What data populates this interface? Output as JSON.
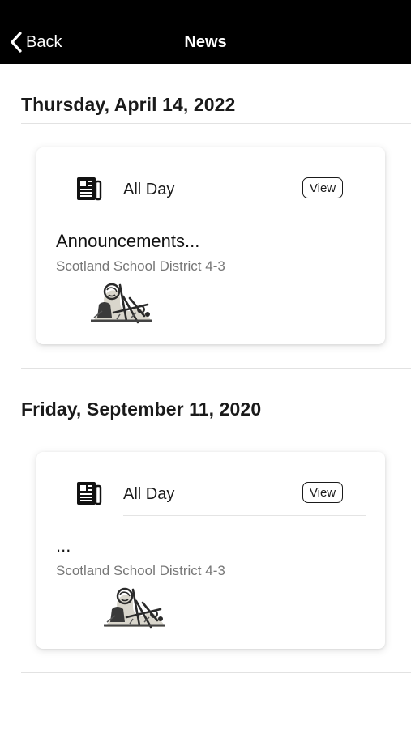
{
  "header": {
    "back_label": "Back",
    "title": "News",
    "background": "#000000"
  },
  "sections": [
    {
      "date": "Thursday, April 14, 2022",
      "card": {
        "icon": "newspaper-icon",
        "time": "All Day",
        "view_label": "View",
        "title": "Announcements...",
        "source": "Scotland School District 4-3",
        "logo": "school-district-logo"
      }
    },
    {
      "date": "Friday, September 11, 2020",
      "card": {
        "icon": "newspaper-icon",
        "time": "All Day",
        "view_label": "View",
        "title": "...",
        "source": "Scotland School District 4-3",
        "logo": "school-district-logo"
      }
    }
  ]
}
